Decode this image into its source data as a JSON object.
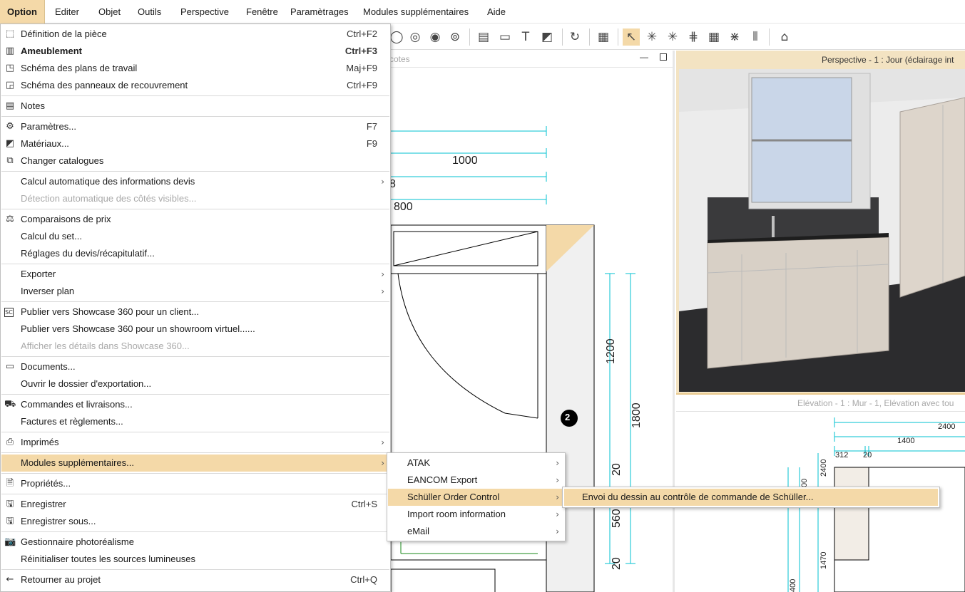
{
  "menubar": [
    "Option",
    "Editer",
    "Objet",
    "Outils",
    "Perspective",
    "Fenêtre",
    "Paramètrages",
    "Modules supplémentaires",
    "Aide"
  ],
  "plan": {
    "title": "cotes",
    "dims": [
      "1000",
      "8",
      "800",
      "1200",
      "1800",
      "20",
      "560",
      "20"
    ],
    "marker": "2"
  },
  "perspective": {
    "title": "Perspective - 1 : Jour (éclairage int"
  },
  "elevation": {
    "title": "Elévation - 1 : Mur - 1, Elévation avec tou",
    "dims": [
      "2400",
      "1400",
      "312",
      "20",
      "2400",
      "1470",
      "400",
      "00"
    ]
  },
  "menu": {
    "items": [
      {
        "label": "Définition de la pièce",
        "shortcut": "Ctrl+F2",
        "icon": "room-definition-icon"
      },
      {
        "label": "Ameublement",
        "shortcut": "Ctrl+F3",
        "icon": "furnishing-icon"
      },
      {
        "label": "Schéma des plans de travail",
        "shortcut": "Maj+F9",
        "icon": "worktop-scheme-icon"
      },
      {
        "label": "Schéma des panneaux de recouvrement",
        "shortcut": "Ctrl+F9",
        "icon": "cover-panel-scheme-icon"
      },
      {
        "label": "Notes",
        "icon": "notes-icon"
      },
      {
        "label": "Paramètres...",
        "shortcut": "F7",
        "icon": "gear-icon"
      },
      {
        "label": "Matériaux...",
        "shortcut": "F9",
        "icon": "materials-icon"
      },
      {
        "label": "Changer catalogues",
        "icon": "catalog-icon"
      },
      {
        "label": "Calcul automatique des informations devis"
      },
      {
        "label": "Détection automatique des côtés visibles..."
      },
      {
        "label": "Comparaisons de prix",
        "icon": "scales-icon"
      },
      {
        "label": "Calcul du set..."
      },
      {
        "label": "Réglages du devis/récapitulatif..."
      },
      {
        "label": "Exporter"
      },
      {
        "label": "Inverser plan"
      },
      {
        "label": "Publier vers Showcase 360 pour un client...",
        "icon": "showcase-icon"
      },
      {
        "label": "Publier vers Showcase 360 pour un showroom virtuel......"
      },
      {
        "label": "Afficher les détails dans Showcase 360..."
      },
      {
        "label": "Documents...",
        "icon": "documents-icon"
      },
      {
        "label": "Ouvrir le dossier d'exportation..."
      },
      {
        "label": "Commandes et livraisons...",
        "icon": "truck-icon"
      },
      {
        "label": "Factures et règlements..."
      },
      {
        "label": "Imprimés",
        "icon": "printer-icon"
      },
      {
        "label": "Modules supplémentaires..."
      },
      {
        "label": "Propriétés...",
        "icon": "properties-icon"
      },
      {
        "label": "Enregistrer",
        "shortcut": "Ctrl+S",
        "icon": "save-icon"
      },
      {
        "label": "Enregistrer sous...",
        "icon": "save-as-icon"
      },
      {
        "label": "Gestionnaire photoréalisme",
        "icon": "camera-icon"
      },
      {
        "label": "Réinitialiser toutes les sources lumineuses"
      },
      {
        "label": "Retourner au projet",
        "shortcut": "Ctrl+Q",
        "icon": "back-arrow-icon"
      }
    ]
  },
  "submenu": {
    "items": [
      {
        "label": "ATAK"
      },
      {
        "label": "EANCOM Export"
      },
      {
        "label": "Schüller Order Control"
      },
      {
        "label": "Import room information"
      },
      {
        "label": "eMail"
      }
    ]
  },
  "subsubmenu": {
    "label": "Envoi du dessin au contrôle de commande de Schüller..."
  },
  "colors": {
    "highlight": "#f4d9a8",
    "dimension_line": "#00c0d0",
    "frame_active": "#e9c98e"
  }
}
